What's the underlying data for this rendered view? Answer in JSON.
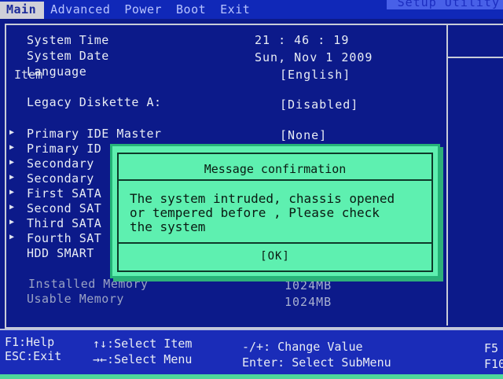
{
  "menu": {
    "tabs": [
      "Main",
      "Advanced",
      "Power",
      "Boot",
      "Exit"
    ],
    "active": "Main",
    "title_strip": "Setup Utility"
  },
  "help": {
    "title": "Item"
  },
  "main": {
    "system_time": {
      "label": "System Time",
      "value": "21 : 46 : 19"
    },
    "system_date": {
      "label": "System Date",
      "value": "Sun, Nov  1 2009"
    },
    "language": {
      "label": "Language",
      "value": "[English]"
    },
    "legacy_diskette": {
      "label": "Legacy Diskette A:",
      "value": "[Disabled]"
    },
    "submenus": [
      {
        "label": "Primary IDE Master",
        "value": "[None]"
      },
      {
        "label": "Primary ID",
        "value": ""
      },
      {
        "label": "Secondary",
        "value": ""
      },
      {
        "label": "Secondary",
        "value": ""
      },
      {
        "label": "First SATA",
        "value": ""
      },
      {
        "label": "Second SAT",
        "value": ""
      },
      {
        "label": "Third SATA",
        "value": ""
      },
      {
        "label": "Fourth SAT",
        "value": ""
      }
    ],
    "hdd_smart": {
      "label": "HDD SMART"
    },
    "installed_memory": {
      "label": "Installed Memory",
      "value": "1024MB"
    },
    "usable_memory": {
      "label": "Usable Memory",
      "value": "1024MB"
    }
  },
  "dialog": {
    "title": "Message confirmation",
    "message": "The system intruded, chassis opened\nor tempered before , Please check\nthe system",
    "ok_label": "[OK]"
  },
  "footer": {
    "f1": "F1:Help",
    "esc": "ESC:Exit",
    "select_item": "↑↓:Select Item",
    "select_menu": "→←:Select Menu",
    "change_value": "-/+: Change Value",
    "enter": "Enter: Select SubMenu",
    "f5": "F5",
    "f10": "F10"
  }
}
